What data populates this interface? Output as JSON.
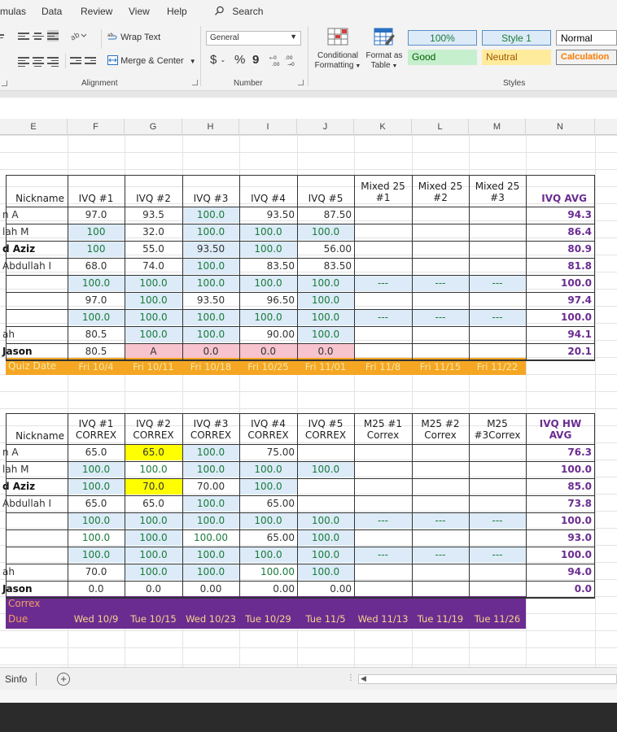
{
  "menu": {
    "items": [
      "mulas",
      "Data",
      "Review",
      "View",
      "Help"
    ],
    "search": "Search"
  },
  "ribbon": {
    "wrap_text": "Wrap Text",
    "merge_center": "Merge & Center",
    "number_format": "General",
    "currency": "$",
    "percent": "%",
    "comma": "9",
    "conditional_formatting": [
      "Conditional",
      "Formatting"
    ],
    "format_as_table": [
      "Format as",
      "Table"
    ],
    "groups": {
      "alignment": "Alignment",
      "number": "Number",
      "styles": "Styles"
    },
    "styles": [
      {
        "label": "100%",
        "bg": "#dcebf7",
        "fg": "#1a7a3d"
      },
      {
        "label": "Style 1",
        "bg": "#dcebf7",
        "fg": "#1a7a3d"
      },
      {
        "label": "Normal",
        "bg": "#ffffff",
        "fg": "#000000"
      },
      {
        "label": "Good",
        "bg": "#c6efce",
        "fg": "#006100"
      },
      {
        "label": "Neutral",
        "bg": "#ffeb9c",
        "fg": "#9c5700"
      },
      {
        "label": "Calculation",
        "bg": "#f2f2f2",
        "fg": "#fa7d00"
      }
    ]
  },
  "columns": [
    "E",
    "F",
    "G",
    "H",
    "I",
    "J",
    "K",
    "L",
    "M",
    "N"
  ],
  "table1": {
    "headers": {
      "nickname": "Nickname",
      "ivq1": "IVQ #1",
      "ivq2": "IVQ #2",
      "ivq3": "IVQ #3",
      "ivq4": "IVQ #4",
      "ivq5": "IVQ #5",
      "mixed1": [
        "Mixed 25",
        "#1"
      ],
      "mixed2": [
        "Mixed 25",
        "#2"
      ],
      "mixed3": [
        "Mixed 25",
        "#3"
      ],
      "avg": "IVQ AVG"
    },
    "rows": [
      {
        "name": "n A",
        "ivq1": "97.0",
        "ivq2": "93.5",
        "ivq3": "100.0",
        "ivq4": "93.50",
        "ivq5": "87.50",
        "m1": "",
        "m2": "",
        "m3": "",
        "avg": "94.3"
      },
      {
        "name": "lah M",
        "ivq1": "100",
        "ivq2": "32.0",
        "ivq3": "100.0",
        "ivq4": "100.0",
        "ivq5": "100.0",
        "m1": "",
        "m2": "",
        "m3": "",
        "avg": "86.4"
      },
      {
        "name": "d Aziz",
        "ivq1": "100",
        "ivq2": "55.0",
        "ivq3": "93.50",
        "ivq4": "100.0",
        "ivq5": "56.00",
        "m1": "",
        "m2": "",
        "m3": "",
        "avg": "80.9"
      },
      {
        "name": "Abdullah I",
        "ivq1": "68.0",
        "ivq2": "74.0",
        "ivq3": "100.0",
        "ivq4": "83.50",
        "ivq5": "83.50",
        "m1": "",
        "m2": "",
        "m3": "",
        "avg": "81.8"
      },
      {
        "name": "",
        "ivq1": "100.0",
        "ivq2": "100.0",
        "ivq3": "100.0",
        "ivq4": "100.0",
        "ivq5": "100.0",
        "m1": "---",
        "m2": "---",
        "m3": "---",
        "avg": "100.0"
      },
      {
        "name": "",
        "ivq1": "97.0",
        "ivq2": "100.0",
        "ivq3": "93.50",
        "ivq4": "96.50",
        "ivq5": "100.0",
        "m1": "",
        "m2": "",
        "m3": "",
        "avg": "97.4"
      },
      {
        "name": "",
        "ivq1": "100.0",
        "ivq2": "100.0",
        "ivq3": "100.0",
        "ivq4": "100.0",
        "ivq5": "100.0",
        "m1": "---",
        "m2": "---",
        "m3": "---",
        "avg": "100.0"
      },
      {
        "name": "ah",
        "ivq1": "80.5",
        "ivq2": "100.0",
        "ivq3": "100.0",
        "ivq4": "90.00",
        "ivq5": "100.0",
        "m1": "",
        "m2": "",
        "m3": "",
        "avg": "94.1"
      },
      {
        "name": "Jason",
        "ivq1": "80.5",
        "ivq2": "A",
        "ivq3": "0.0",
        "ivq4": "0.0",
        "ivq5": "0.0",
        "m1": "",
        "m2": "",
        "m3": "",
        "avg": "20.1"
      }
    ],
    "date_label": "Quiz Date",
    "dates": [
      "Fri 10/4",
      "Fri 10/11",
      "Fri 10/18",
      "Fri 10/25",
      "Fri 11/01",
      "Fri 11/8",
      "Fri 11/15",
      "Fri 11/22"
    ]
  },
  "table2": {
    "headers": {
      "nickname": "Nickname",
      "c1": [
        "IVQ #1",
        "CORREX"
      ],
      "c2": [
        "IVQ #2",
        "CORREX"
      ],
      "c3": [
        "IVQ #3",
        "CORREX"
      ],
      "c4": [
        "IVQ #4",
        "CORREX"
      ],
      "c5": [
        "IVQ #5",
        "CORREX"
      ],
      "m1": [
        "M25 #1",
        "Correx"
      ],
      "m2": [
        "M25 #2",
        "Correx"
      ],
      "m3": [
        "M25",
        "#3Correx"
      ],
      "avg": [
        "IVQ HW",
        "AVG"
      ]
    },
    "rows": [
      {
        "name": "n A",
        "c1": "65.0",
        "c2": "65.0",
        "c3": "100.0",
        "c4": "75.00",
        "c5": "",
        "m1": "",
        "m2": "",
        "m3": "",
        "avg": "76.3"
      },
      {
        "name": "lah M",
        "c1": "100.0",
        "c2": "100.0",
        "c3": "100.0",
        "c4": "100.0",
        "c5": "100.0",
        "m1": "",
        "m2": "",
        "m3": "",
        "avg": "100.0"
      },
      {
        "name": "d Aziz",
        "c1": "100.0",
        "c2": "70.0",
        "c3": "70.00",
        "c4": "100.0",
        "c5": "",
        "m1": "",
        "m2": "",
        "m3": "",
        "avg": "85.0"
      },
      {
        "name": "Abdullah I",
        "c1": "65.0",
        "c2": "65.0",
        "c3": "100.0",
        "c4": "65.00",
        "c5": "",
        "m1": "",
        "m2": "",
        "m3": "",
        "avg": "73.8"
      },
      {
        "name": "",
        "c1": "100.0",
        "c2": "100.0",
        "c3": "100.0",
        "c4": "100.0",
        "c5": "100.0",
        "m1": "---",
        "m2": "---",
        "m3": "---",
        "avg": "100.0"
      },
      {
        "name": "",
        "c1": "100.0",
        "c2": "100.0",
        "c3": "100.00",
        "c4": "65.00",
        "c5": "100.0",
        "m1": "",
        "m2": "",
        "m3": "",
        "avg": "93.0"
      },
      {
        "name": "",
        "c1": "100.0",
        "c2": "100.0",
        "c3": "100.0",
        "c4": "100.0",
        "c5": "100.0",
        "m1": "---",
        "m2": "---",
        "m3": "---",
        "avg": "100.0"
      },
      {
        "name": "ah",
        "c1": "70.0",
        "c2": "100.0",
        "c3": "100.0",
        "c4": "100.00",
        "c5": "100.0",
        "m1": "",
        "m2": "",
        "m3": "",
        "avg": "94.0"
      },
      {
        "name": "Jason",
        "c1": "0.0",
        "c2": "0.0",
        "c3": "0.00",
        "c4": "0.00",
        "c5": "0.00",
        "m1": "",
        "m2": "",
        "m3": "",
        "avg": "0.0"
      }
    ],
    "due_label": [
      "Correx",
      "Due"
    ],
    "dates": [
      "Wed 10/9",
      "Tue 10/15",
      "Wed 10/23",
      "Tue 10/29",
      "Tue 11/5",
      "Wed 11/13",
      "Tue 11/19",
      "Tue 11/26"
    ]
  },
  "sheetbar": {
    "tab": "Sinfo",
    "add": "+"
  }
}
